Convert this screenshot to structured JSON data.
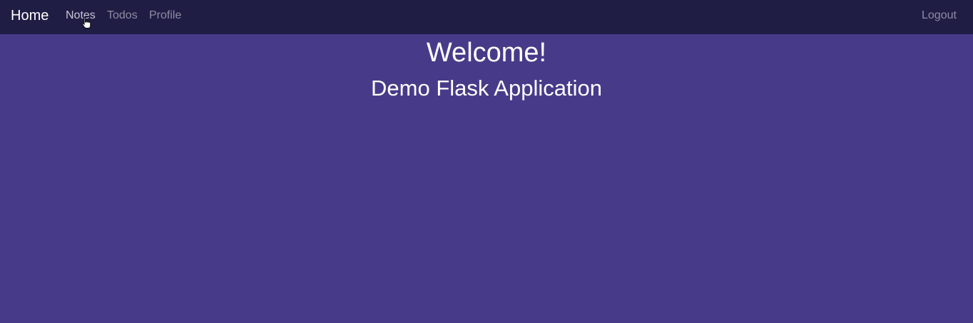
{
  "navbar": {
    "brand": "Home",
    "links": [
      {
        "label": "Notes"
      },
      {
        "label": "Todos"
      },
      {
        "label": "Profile"
      }
    ],
    "logout": "Logout"
  },
  "main": {
    "title": "Welcome!",
    "subtitle": "Demo Flask Application"
  },
  "colors": {
    "navbar_bg": "#201d45",
    "page_bg": "#473b89",
    "link_muted": "#8f8ca3",
    "text": "#ffffff"
  },
  "cursor": {
    "icon": "hand-pointer-icon"
  }
}
